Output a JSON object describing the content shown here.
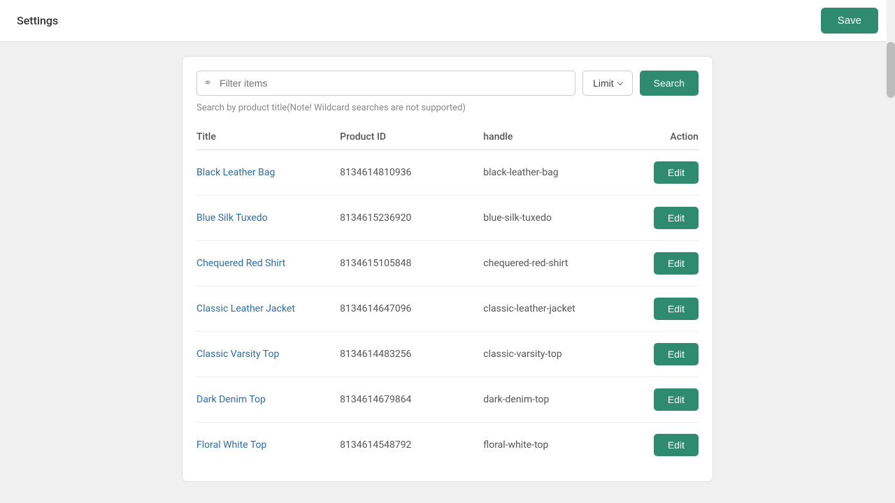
{
  "header": {
    "title": "Settings",
    "save_label": "Save"
  },
  "search": {
    "placeholder": "Filter items",
    "hint": "Search by product title(Note! Wildcard searches are not supported)",
    "limit_label": "Limit",
    "search_label": "Search"
  },
  "table": {
    "columns": {
      "title": "Title",
      "product_id": "Product ID",
      "handle": "handle",
      "action": "Action"
    },
    "rows": [
      {
        "title": "Black Leather Bag",
        "product_id": "8134614810936",
        "handle": "black-leather-bag"
      },
      {
        "title": "Blue Silk Tuxedo",
        "product_id": "8134615236920",
        "handle": "blue-silk-tuxedo"
      },
      {
        "title": "Chequered Red Shirt",
        "product_id": "8134615105848",
        "handle": "chequered-red-shirt"
      },
      {
        "title": "Classic Leather Jacket",
        "product_id": "8134614647096",
        "handle": "classic-leather-jacket"
      },
      {
        "title": "Classic Varsity Top",
        "product_id": "8134614483256",
        "handle": "classic-varsity-top"
      },
      {
        "title": "Dark Denim Top",
        "product_id": "8134614679864",
        "handle": "dark-denim-top"
      },
      {
        "title": "Floral White Top",
        "product_id": "8134614548792",
        "handle": "floral-white-top"
      }
    ],
    "edit_label": "Edit"
  },
  "colors": {
    "accent": "#2e8b6e",
    "title_link": "#2e6da4"
  }
}
